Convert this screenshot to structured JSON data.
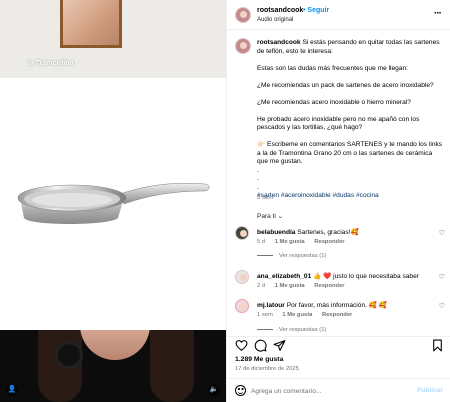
{
  "media": {
    "product_label": "la Tramontina"
  },
  "header": {
    "username": "rootsandcook",
    "follow_label": "Seguir",
    "audio": "Audio original",
    "more_icon": "more-horizontal-icon"
  },
  "caption": {
    "username": "rootsandcook",
    "intro": "Si estás pensando en quitar todas las sartenes de teflón, esto te interesa:",
    "p1": "Estas son las dudas más frecuentes que me llegan:",
    "p2": "¿Me recomiendas un pack de sartenes de acero inoxidable?",
    "p3": "¿Me recomiendas acero inoxidable o hierro mineral?",
    "p4": "He probado acero inoxidable pero no me apañó con los pescados y las tortillas, ¿qué hago?",
    "p5": "👉🏻 Escribeme en comentarios SARTENES y te mando los links a la de Tramontina Grano 20 cm o las sartenes de cerámica que me gustan.",
    "dots": [
      ".",
      ".",
      "."
    ],
    "hashtags": "#sarten #aceroinoxidable #dudas #cocina",
    "time": "5 sem"
  },
  "para_ti": "Para ti",
  "comments": [
    {
      "username": "belabuendia",
      "text": "Sartenes, gracias!🥰",
      "age": "5 d",
      "likes": "1 Me gusta",
      "reply": "Responder",
      "replies": "Ver respuestas (1)"
    },
    {
      "username": "ana_elizabeth_01",
      "text": "👍 ❤️ justo lo que necesitaba saber",
      "age": "2 d",
      "likes": "1 Me gusta",
      "reply": "Responder"
    },
    {
      "username": "mj.latour",
      "text": "Por favor, más información. 🥰 🥰",
      "age": "1 sem",
      "likes": "1 Me gusta",
      "reply": "Responder",
      "replies": "Ver respuestas (1)"
    }
  ],
  "actions": {
    "like_icon": "heart-icon",
    "comment_icon": "comment-icon",
    "share_icon": "share-icon",
    "save_icon": "bookmark-icon"
  },
  "likes": "1.289 Me gusta",
  "date": "17 de diciembre de 2025",
  "comment_box": {
    "placeholder": "Agrega un comentario...",
    "publish_label": "Publicar"
  }
}
